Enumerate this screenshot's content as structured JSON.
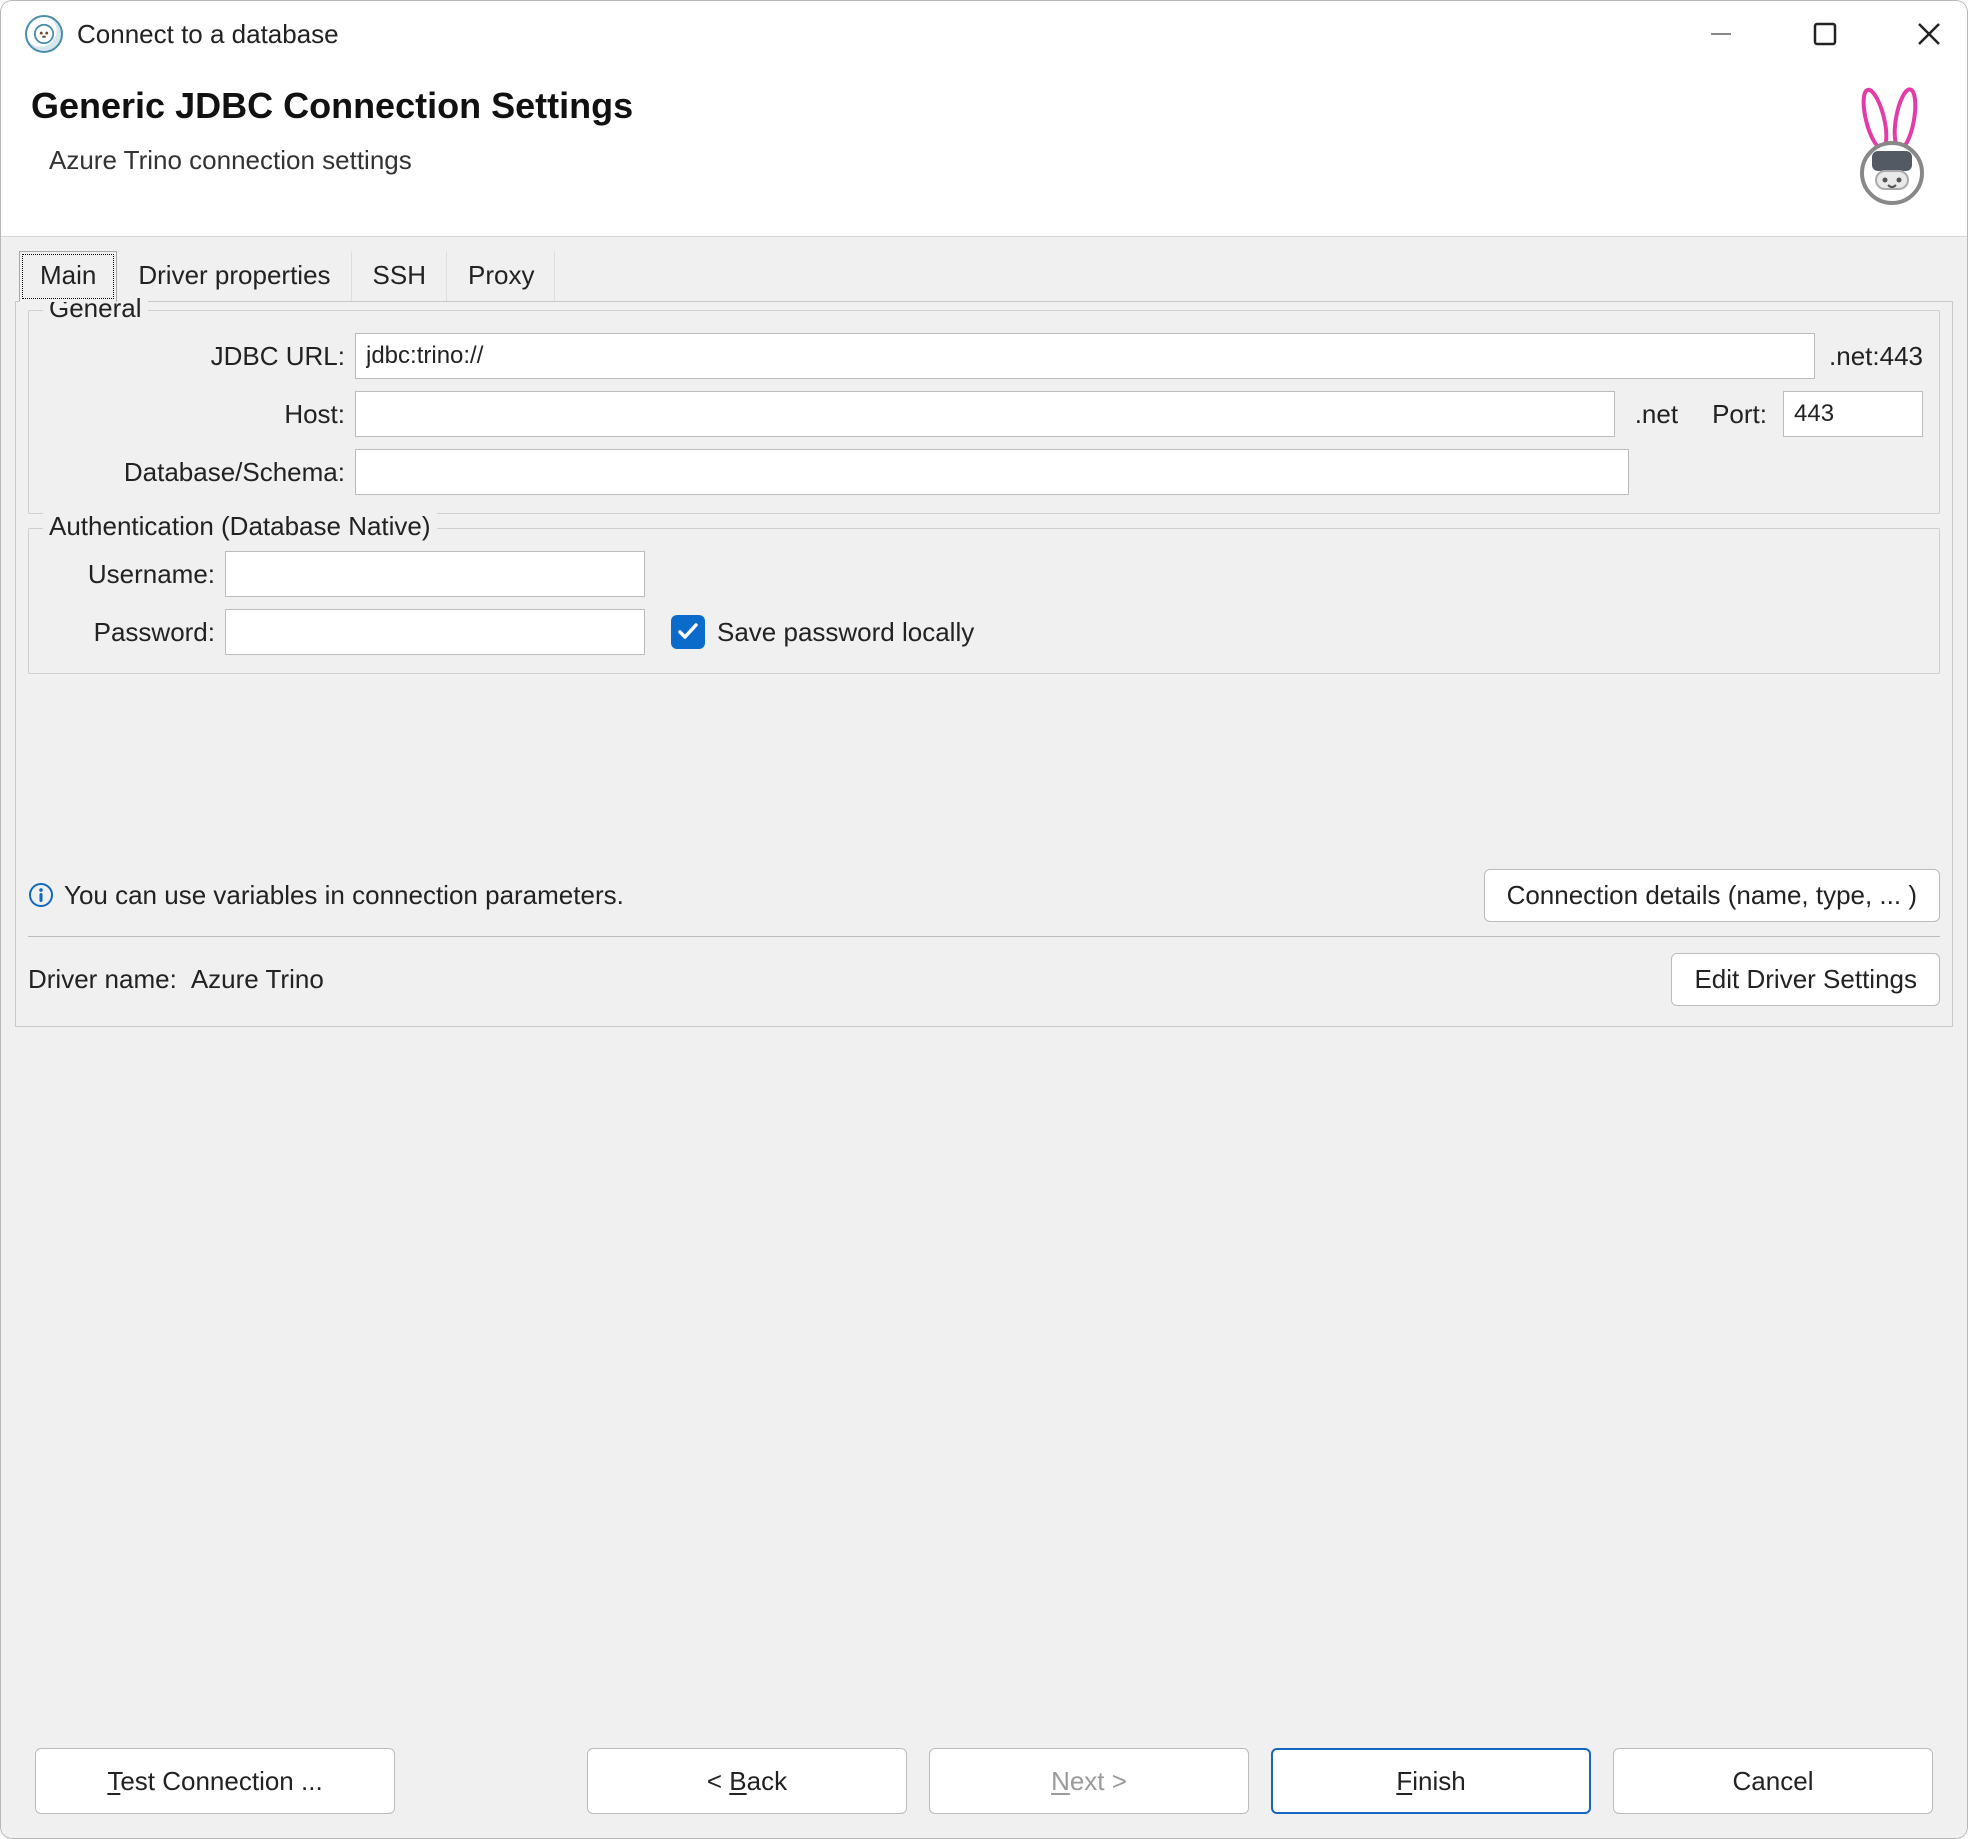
{
  "window": {
    "title": "Connect to a database"
  },
  "headline": {
    "title": "Generic JDBC Connection Settings",
    "subtitle": "Azure Trino connection settings"
  },
  "tabs": {
    "items": [
      {
        "label": "Main"
      },
      {
        "label": "Driver properties"
      },
      {
        "label": "SSH"
      },
      {
        "label": "Proxy"
      }
    ],
    "active_index": 0
  },
  "general": {
    "legend": "General",
    "jdbc_url_label": "JDBC URL:",
    "jdbc_url_value": "jdbc:trino://",
    "jdbc_url_suffix": ".net:443",
    "host_label": "Host:",
    "host_value": "",
    "host_suffix": ".net",
    "port_label": "Port:",
    "port_value": "443",
    "dbschema_label": "Database/Schema:",
    "dbschema_value": ""
  },
  "auth": {
    "legend": "Authentication (Database Native)",
    "username_label": "Username:",
    "username_value": "",
    "password_label": "Password:",
    "password_value": "",
    "save_pw_checked": true,
    "save_pw_label": "Save password locally"
  },
  "infoRow": {
    "text": "You can use variables in connection parameters.",
    "conn_details_btn": "Connection details (name, type, ... )"
  },
  "driverRow": {
    "label": "Driver name:",
    "value": "Azure Trino",
    "edit_btn": "Edit Driver Settings"
  },
  "footer": {
    "test": "Test Connection ...",
    "back_prefix": "< ",
    "back_key": "B",
    "back_rest": "ack",
    "next_key": "N",
    "next_rest": "ext >",
    "finish_key": "F",
    "finish_rest": "inish",
    "cancel": "Cancel"
  }
}
